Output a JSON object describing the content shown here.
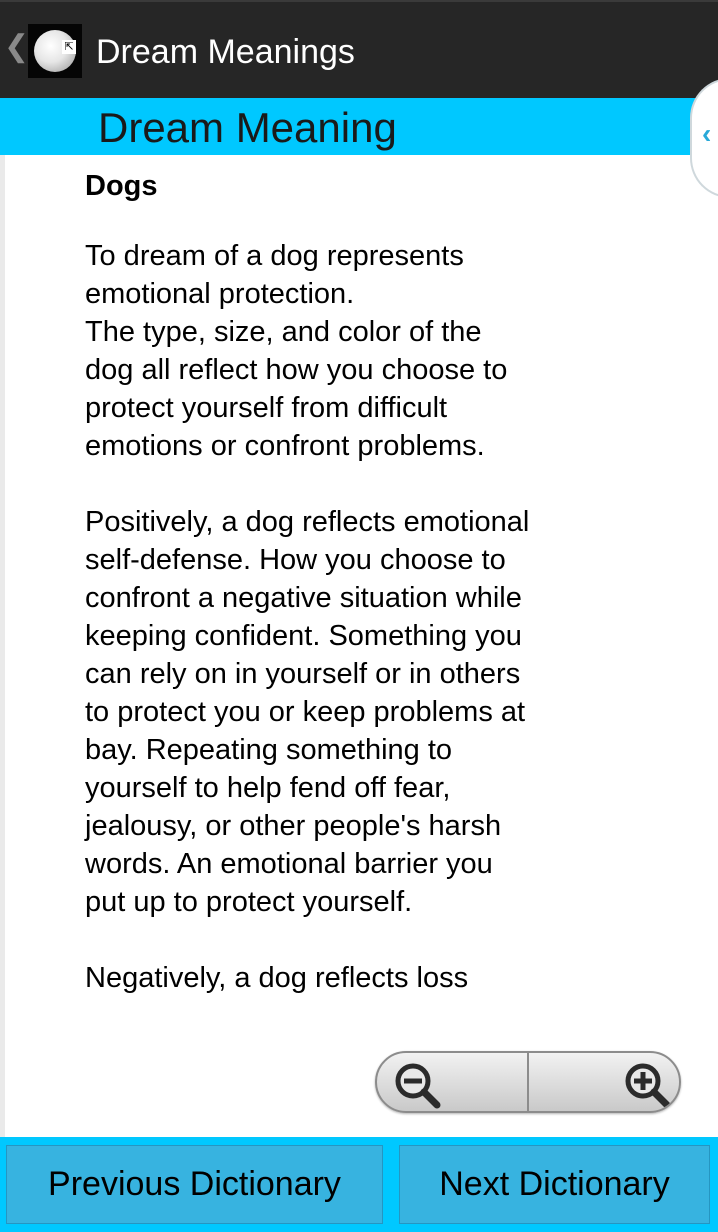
{
  "app": {
    "title": "Dream Meanings",
    "icon_badge": "⇱"
  },
  "section": {
    "title": "Dream Meaning"
  },
  "article": {
    "word": "Dogs",
    "paragraphs": [
      "To dream of a dog represents emotional protection.\nThe type, size, and color of the dog all reflect how you choose to protect yourself from difficult emotions or confront problems.",
      "Positively, a dog reflects emotional self-defense. How you choose to confront a negative situation while keeping confident. Something you can rely on in yourself or in others to protect you or keep problems at bay. Repeating something to yourself to help fend off fear, jealousy, or other people's harsh words. An emotional barrier you put up to protect yourself.",
      "Negatively, a dog reflects loss"
    ]
  },
  "zoom": {
    "zoom_out_icon": "magnifier-minus-icon",
    "zoom_in_icon": "magnifier-plus-icon"
  },
  "nav": {
    "previous_label": "Previous Dictionary",
    "next_label": "Next Dictionary"
  },
  "colors": {
    "action_bar": "#262626",
    "accent": "#00c8ff",
    "button": "#37b3e0"
  }
}
